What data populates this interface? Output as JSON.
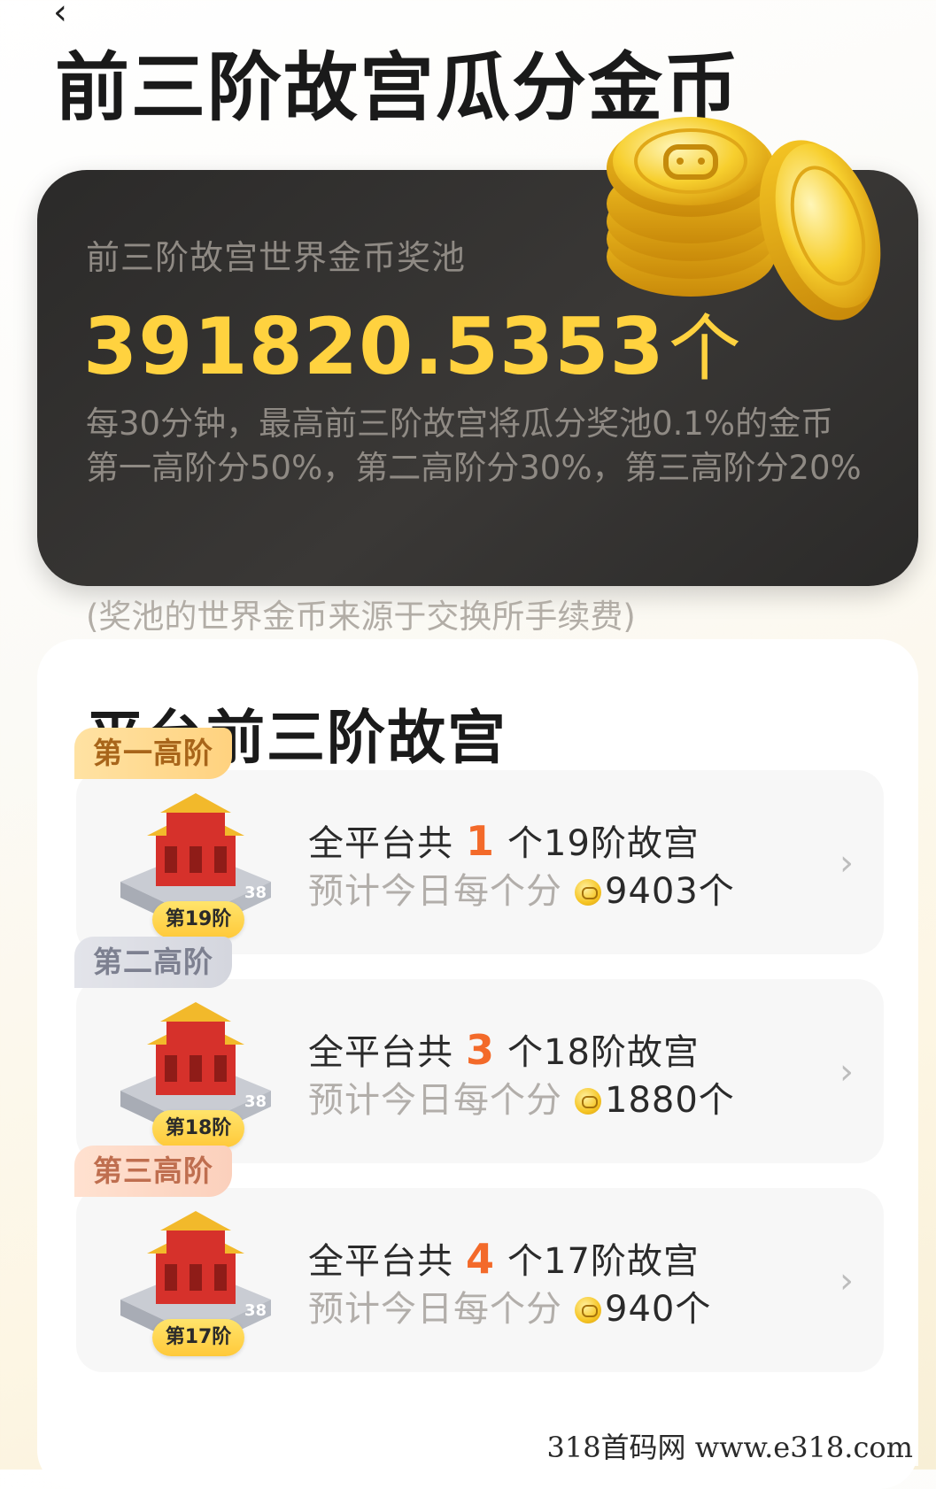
{
  "header": {
    "back_icon": "chevron-left-icon",
    "title": "前三阶故宫瓜分金币"
  },
  "pool": {
    "label": "前三阶故宫世界金币奖池",
    "amount": "391820.5353",
    "unit": "个",
    "desc_line1": "每30分钟，最高前三阶故宫将瓜分奖池0.1%的金币",
    "desc_line2": "第一高阶分50%，第二高阶分30%，第三高阶分20%",
    "note": "(奖池的世界金币来源于交换所手续费)",
    "accent_color": "#ffd23f"
  },
  "ranks_section": {
    "title": "平台前三阶故宫",
    "items": [
      {
        "tag": "第一高阶",
        "badge": "第19阶",
        "prefix": "全平台共",
        "count": "1",
        "suffix": "个19阶故宫",
        "estimate_label": "预计今日每个分",
        "amount": "9403个"
      },
      {
        "tag": "第二高阶",
        "badge": "第18阶",
        "prefix": "全平台共",
        "count": "3",
        "suffix": "个18阶故宫",
        "estimate_label": "预计今日每个分",
        "amount": "1880个"
      },
      {
        "tag": "第三高阶",
        "badge": "第17阶",
        "prefix": "全平台共",
        "count": "4",
        "suffix": "个17阶故宫",
        "estimate_label": "预计今日每个分",
        "amount": "940个"
      }
    ]
  },
  "watermark": "318首码网  www.e318.com"
}
